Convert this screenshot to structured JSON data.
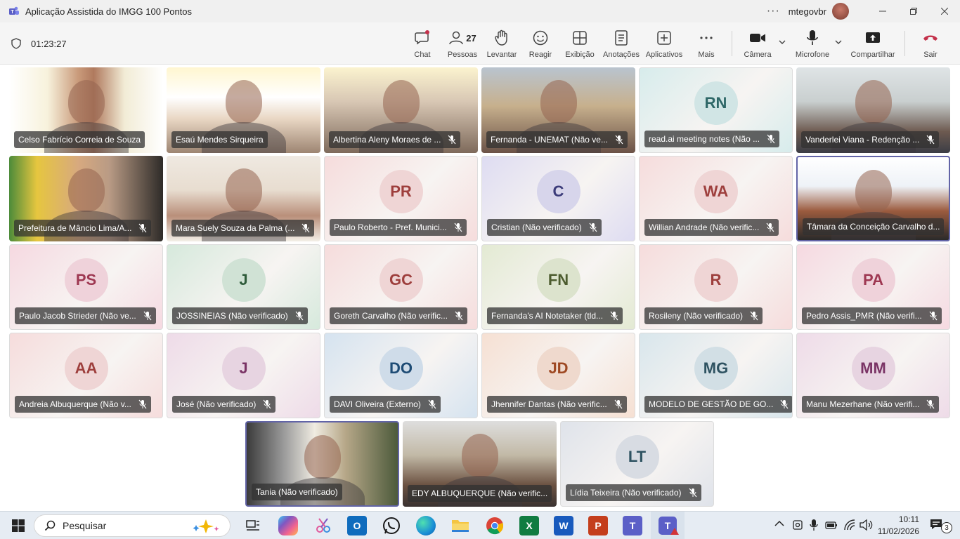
{
  "window": {
    "title": "Aplicação Assistida do IMGG 100 Pontos",
    "user": "mtegovbr",
    "more": "···"
  },
  "meeting": {
    "timer": "01:23:27",
    "people_count": "27"
  },
  "toolbar": [
    {
      "label": "Chat",
      "icon": "chat-icon"
    },
    {
      "label": "Pessoas",
      "icon": "people-icon"
    },
    {
      "label": "Levantar",
      "icon": "raise-hand-icon"
    },
    {
      "label": "Reagir",
      "icon": "react-icon"
    },
    {
      "label": "Exibição",
      "icon": "view-icon"
    },
    {
      "label": "Anotações",
      "icon": "notes-icon"
    },
    {
      "label": "Aplicativos",
      "icon": "apps-icon"
    },
    {
      "label": "Mais",
      "icon": "more-icon"
    },
    {
      "label": "Câmera",
      "icon": "camera-icon"
    },
    {
      "label": "Microfone",
      "icon": "microphone-icon"
    },
    {
      "label": "Compartilhar",
      "icon": "share-icon"
    },
    {
      "label": "Sair",
      "icon": "leave-icon"
    }
  ],
  "participants": [
    {
      "name": "Celso Fabrício Correia de Souza",
      "video": true,
      "muted": false
    },
    {
      "name": "Esaú Mendes Sirqueira",
      "video": true,
      "muted": false
    },
    {
      "name": "Albertina Aleny Moraes de ...",
      "video": true,
      "muted": true
    },
    {
      "name": "Fernanda - UNEMAT (Não ve...",
      "video": true,
      "muted": true
    },
    {
      "name": "read.ai meeting notes (Não ...",
      "initials": "RN",
      "muted": true,
      "color": "#2f6a6a",
      "bg": "#d7ecec"
    },
    {
      "name": "Vanderlei Viana - Redenção ...",
      "video": true,
      "muted": true
    },
    {
      "name": "Prefeitura de Mâncio Lima/A...",
      "video": true,
      "muted": true
    },
    {
      "name": "Mara Suely Souza da Palma (...",
      "video": true,
      "muted": true
    },
    {
      "name": "Paulo Roberto - Pref. Munici...",
      "initials": "PR",
      "muted": true,
      "color": "#a3413f",
      "bg": "#f6dcdc"
    },
    {
      "name": "Cristian (Não verificado)",
      "initials": "C",
      "muted": true,
      "color": "#3e3e7e",
      "bg": "#dedcf2"
    },
    {
      "name": "Willian Andrade (Não verific...",
      "initials": "WA",
      "muted": true,
      "color": "#a3413f",
      "bg": "#f6dcdc"
    },
    {
      "name": "Tâmara da Conceição Carvalho d...",
      "video": true,
      "muted": false,
      "active": true
    },
    {
      "name": "Paulo Jacob Strieder (Não ve...",
      "initials": "PS",
      "muted": true,
      "color": "#a33a55",
      "bg": "#f6d9e1"
    },
    {
      "name": "JOSSINEIAS (Não verificado)",
      "initials": "J",
      "muted": true,
      "color": "#2f5e3c",
      "bg": "#d6e9dc"
    },
    {
      "name": "Goreth Carvalho (Não verific...",
      "initials": "GC",
      "muted": true,
      "color": "#a3413f",
      "bg": "#f6dcdc"
    },
    {
      "name": "Fernanda's AI Notetaker (tld...",
      "initials": "FN",
      "muted": true,
      "color": "#4f5f30",
      "bg": "#e3ead3"
    },
    {
      "name": "Rosileny (Não verificado)",
      "initials": "R",
      "muted": true,
      "color": "#a3413f",
      "bg": "#f6dcdc"
    },
    {
      "name": "Pedro Assis_PMR (Não verifi...",
      "initials": "PA",
      "muted": true,
      "color": "#a33a55",
      "bg": "#f6d9e1"
    },
    {
      "name": "Andreia Albuquerque (Não v...",
      "initials": "AA",
      "muted": true,
      "color": "#a3413f",
      "bg": "#f6dcdc"
    },
    {
      "name": "José (Não verificado)",
      "initials": "J",
      "muted": true,
      "color": "#7e3568",
      "bg": "#eedbe8"
    },
    {
      "name": "DAVI Oliveira (Externo)",
      "initials": "DO",
      "muted": true,
      "color": "#1f4e79",
      "bg": "#d5e3f0"
    },
    {
      "name": "Jhennifer Dantas (Não verific...",
      "initials": "JD",
      "muted": true,
      "color": "#a34a23",
      "bg": "#f6e0d3"
    },
    {
      "name": "MODELO DE GESTÃO DE GO...",
      "initials": "MG",
      "muted": true,
      "color": "#2f5564",
      "bg": "#d8e6ec"
    },
    {
      "name": "Manu Mezerhane (Não verifi...",
      "initials": "MM",
      "muted": true,
      "color": "#7e3568",
      "bg": "#eedbe8"
    },
    {
      "name": "Tania (Não verificado)",
      "video": true,
      "muted": false,
      "active": true
    },
    {
      "name": "EDY ALBUQUERQUE (Não verific...",
      "video": true,
      "muted": false
    },
    {
      "name": "Lídia Teixeira (Não verificado)",
      "initials": "LT",
      "muted": true,
      "color": "#2f5564",
      "bg": "#dfe3ea"
    }
  ],
  "taskbar": {
    "search_placeholder": "Pesquisar",
    "time": "10:11",
    "date": "11/02/2026",
    "notifications": "3",
    "apps": [
      "task-view-icon",
      "copilot-icon",
      "snipping-tool-icon",
      "outlook-icon",
      "whatsapp-icon",
      "edge-icon",
      "file-explorer-icon",
      "chrome-icon",
      "excel-icon",
      "word-icon",
      "powerpoint-icon",
      "teams-icon",
      "teams-meeting-icon"
    ]
  },
  "colors": {
    "accent": "#6264a7",
    "leave": "#c4314b",
    "nameplate": "#323232"
  }
}
